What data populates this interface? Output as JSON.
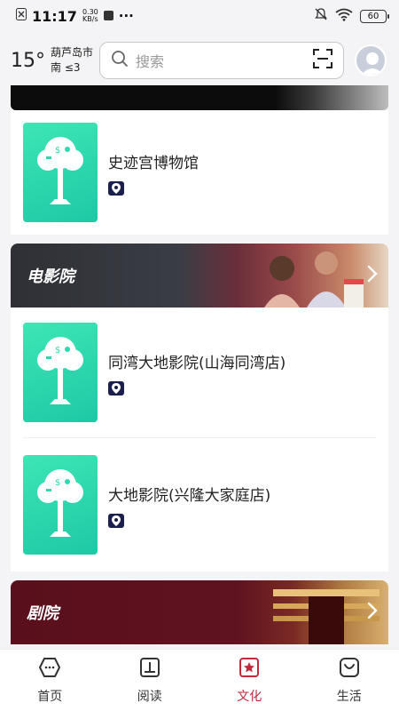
{
  "status_bar": {
    "time": "11:17",
    "speed_value": "0.30",
    "speed_unit": "KB/s",
    "dots": "···",
    "battery": "60"
  },
  "header": {
    "temperature": "15°",
    "city": "葫芦岛市",
    "wind": "南  ≤3",
    "search_placeholder": "搜索"
  },
  "venues_group1": [
    {
      "name": "史迹宫博物馆"
    }
  ],
  "sections": {
    "cinema": {
      "title": "电影院"
    },
    "theater": {
      "title": "剧院"
    }
  },
  "cinemas": [
    {
      "name": "同湾大地影院(山海同湾店)"
    },
    {
      "name": "大地影院(兴隆大家庭店)"
    }
  ],
  "bottom_nav": [
    {
      "label": "首页",
      "icon": "home-icon"
    },
    {
      "label": "阅读",
      "icon": "book-icon"
    },
    {
      "label": "文化",
      "icon": "star-box-icon"
    },
    {
      "label": "生活",
      "icon": "bag-icon"
    }
  ],
  "colors": {
    "accent": "#c22a3c",
    "thumb": "#2fd8ae"
  }
}
